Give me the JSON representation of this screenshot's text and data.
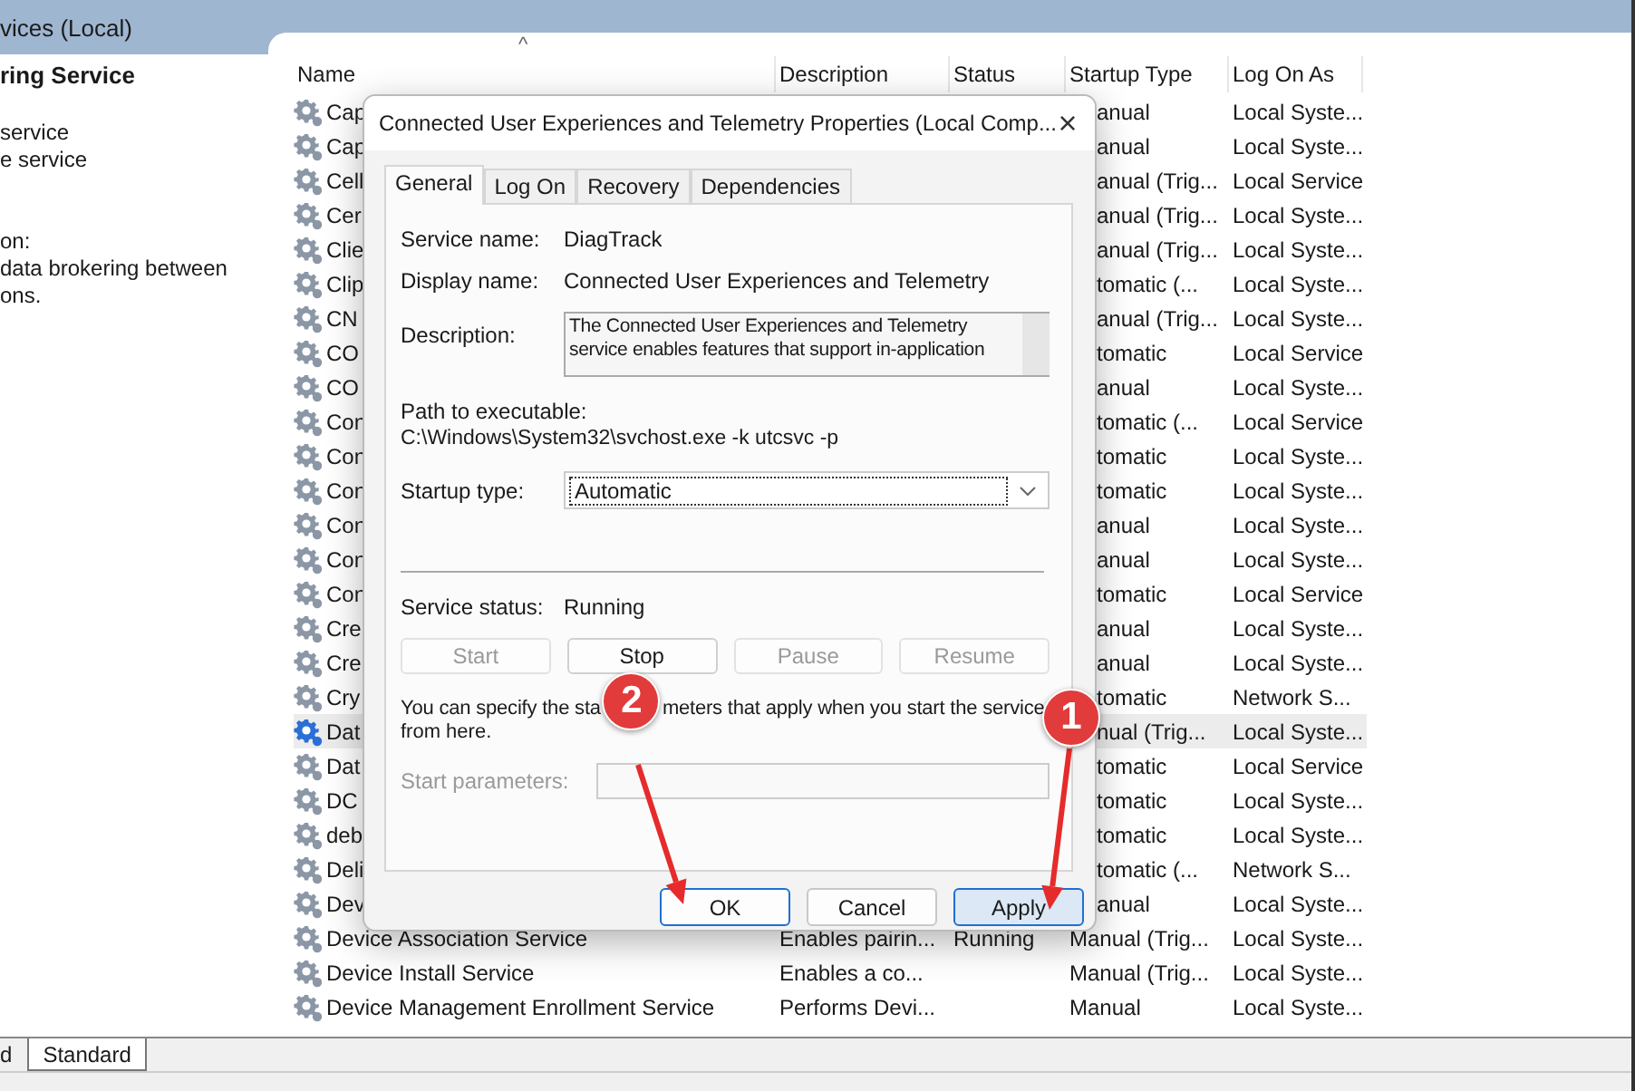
{
  "console_header": {
    "title": "vices (Local)"
  },
  "left_pane": {
    "title": "ring Service",
    "actions": [
      "service",
      "e service"
    ],
    "description_heading": "on:",
    "description_lines": [
      "data brokering between",
      "ons."
    ]
  },
  "table": {
    "sort_indicator": "^",
    "columns": [
      "Name",
      "Description",
      "Status",
      "Startup Type",
      "Log On As"
    ],
    "rows": [
      {
        "name": "Cap",
        "startup": "anual",
        "logon": "Local Syste...",
        "selected": false
      },
      {
        "name": "Cap",
        "startup": "anual",
        "logon": "Local Syste...",
        "selected": false
      },
      {
        "name": "Cell",
        "startup": "anual (Trig...",
        "logon": "Local Service",
        "selected": false
      },
      {
        "name": "Cer",
        "startup": "anual (Trig...",
        "logon": "Local Syste...",
        "selected": false
      },
      {
        "name": "Clie",
        "startup": "anual (Trig...",
        "logon": "Local Syste...",
        "selected": false
      },
      {
        "name": "Clip",
        "startup": "tomatic (...",
        "logon": "Local Syste...",
        "selected": false
      },
      {
        "name": "CN",
        "startup": "anual (Trig...",
        "logon": "Local Syste...",
        "selected": false
      },
      {
        "name": "CO",
        "startup": "tomatic",
        "logon": "Local Service",
        "selected": false
      },
      {
        "name": "CO",
        "startup": "anual",
        "logon": "Local Syste...",
        "selected": false
      },
      {
        "name": "Con",
        "startup": "tomatic (...",
        "logon": "Local Service",
        "selected": false
      },
      {
        "name": "Con",
        "startup": "tomatic",
        "logon": "Local Syste...",
        "selected": false
      },
      {
        "name": "Con",
        "startup": "tomatic",
        "logon": "Local Syste...",
        "selected": false
      },
      {
        "name": "Con",
        "startup": "anual",
        "logon": "Local Syste...",
        "selected": false
      },
      {
        "name": "Con",
        "startup": "anual",
        "logon": "Local Syste...",
        "selected": false
      },
      {
        "name": "Con",
        "startup": "tomatic",
        "logon": "Local Service",
        "selected": false
      },
      {
        "name": "Cre",
        "startup": "anual",
        "logon": "Local Syste...",
        "selected": false
      },
      {
        "name": "Cre",
        "startup": "anual",
        "logon": "Local Syste...",
        "selected": false
      },
      {
        "name": "Cry",
        "startup": "tomatic",
        "logon": "Network S...",
        "selected": false
      },
      {
        "name": "Dat",
        "startup": "nual (Trig...",
        "logon": "Local Syste...",
        "selected": true
      },
      {
        "name": "Dat",
        "startup": "tomatic",
        "logon": "Local Service",
        "selected": false
      },
      {
        "name": "DC",
        "startup": "tomatic",
        "logon": "Local Syste...",
        "selected": false
      },
      {
        "name": "deb",
        "startup": "tomatic",
        "logon": "Local Syste...",
        "selected": false
      },
      {
        "name": "Deli",
        "startup": "tomatic (...",
        "logon": "Network S...",
        "selected": false
      },
      {
        "name": "Dev",
        "startup": "anual",
        "logon": "Local Syste...",
        "selected": false
      },
      {
        "name": "Device Association Service",
        "description": "Enables pairin...",
        "status": "Running",
        "startup": "Manual (Trig...",
        "logon": "Local Syste...",
        "selected": false
      },
      {
        "name": "Device Install Service",
        "description": "Enables a co...",
        "startup": "Manual (Trig...",
        "logon": "Local Syste...",
        "selected": false
      },
      {
        "name": "Device Management Enrollment Service",
        "description": "Performs Devi...",
        "startup": "Manual",
        "logon": "Local Syste...",
        "selected": false
      }
    ]
  },
  "view_tabs": [
    "d",
    "Standard"
  ],
  "dialog": {
    "title": "Connected User Experiences and Telemetry Properties (Local Comp...",
    "close": "×",
    "tabs": [
      {
        "label": "General",
        "selected": true
      },
      {
        "label": "Log On",
        "selected": false
      },
      {
        "label": "Recovery",
        "selected": false
      },
      {
        "label": "Dependencies",
        "selected": false
      }
    ],
    "service_name": {
      "label": "Service name:",
      "value": "DiagTrack"
    },
    "display_name": {
      "label": "Display name:",
      "value": "Connected User Experiences and Telemetry"
    },
    "description": {
      "label": "Description:",
      "value": "The Connected User Experiences and Telemetry service enables features that support in-application"
    },
    "path": {
      "label": "Path to executable:",
      "value": "C:\\Windows\\System32\\svchost.exe -k utcsvc -p"
    },
    "startup_type": {
      "label": "Startup type:",
      "value": "Automatic"
    },
    "service_status": {
      "label": "Service status:",
      "value": "Running"
    },
    "control_buttons": [
      {
        "label": "Start",
        "disabled": true
      },
      {
        "label": "Stop",
        "disabled": false
      },
      {
        "label": "Pause",
        "disabled": true
      },
      {
        "label": "Resume",
        "disabled": true
      }
    ],
    "hint": {
      "before_badge": "You can specify the sta",
      "after_badge": "meters that apply when you start the service",
      "second_line": "from here."
    },
    "start_parameters": {
      "label": "Start parameters:",
      "disabled": true
    },
    "footer_buttons": [
      {
        "label": "OK",
        "kind": "default"
      },
      {
        "label": "Cancel",
        "kind": "normal"
      },
      {
        "label": "Apply",
        "kind": "hover"
      }
    ]
  },
  "annotations": [
    {
      "label": "2"
    },
    {
      "label": "1"
    }
  ]
}
